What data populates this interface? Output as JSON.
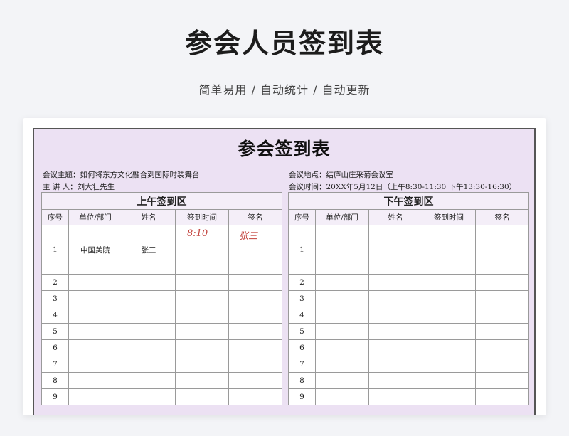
{
  "header": {
    "title": "参会人员签到表",
    "subtitle": "简单易用 / 自动统计 / 自动更新"
  },
  "sheet": {
    "title": "参会签到表",
    "info": {
      "topic": "会议主题：如何将东方文化融合到国际时装舞台",
      "speaker": "主 讲 人：刘大壮先生",
      "location": "会议地点：结庐山庄采菊会议室",
      "time": "会议时间：20XX年5月12日（上午8:30-11:30    下午13:30-16:30）"
    },
    "morning": {
      "section_title": "上午签到区",
      "columns": [
        "序号",
        "单位/部门",
        "姓名",
        "签到时间",
        "签名"
      ],
      "rows": [
        {
          "no": "1",
          "dept": "中国美院",
          "name": "张三",
          "time": "8:10",
          "sign": "张三"
        },
        {
          "no": "2",
          "dept": "",
          "name": "",
          "time": "",
          "sign": ""
        },
        {
          "no": "3",
          "dept": "",
          "name": "",
          "time": "",
          "sign": ""
        },
        {
          "no": "4",
          "dept": "",
          "name": "",
          "time": "",
          "sign": ""
        },
        {
          "no": "5",
          "dept": "",
          "name": "",
          "time": "",
          "sign": ""
        },
        {
          "no": "6",
          "dept": "",
          "name": "",
          "time": "",
          "sign": ""
        },
        {
          "no": "7",
          "dept": "",
          "name": "",
          "time": "",
          "sign": ""
        },
        {
          "no": "8",
          "dept": "",
          "name": "",
          "time": "",
          "sign": ""
        },
        {
          "no": "9",
          "dept": "",
          "name": "",
          "time": "",
          "sign": ""
        }
      ]
    },
    "afternoon": {
      "section_title": "下午签到区",
      "columns": [
        "序号",
        "单位/部门",
        "姓名",
        "签到时间",
        "签名"
      ],
      "rows": [
        {
          "no": "1"
        },
        {
          "no": "2"
        },
        {
          "no": "3"
        },
        {
          "no": "4"
        },
        {
          "no": "5"
        },
        {
          "no": "6"
        },
        {
          "no": "7"
        },
        {
          "no": "8"
        },
        {
          "no": "9"
        }
      ]
    }
  }
}
